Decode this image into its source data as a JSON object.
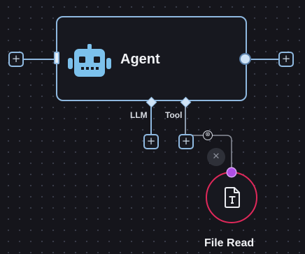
{
  "canvas": {
    "background": "#15151b",
    "accent": "#8fb9e0"
  },
  "agent_node": {
    "title": "Agent",
    "icon": "robot-icon"
  },
  "ports": {
    "llm_label": "LLM",
    "tool_label": "Tool"
  },
  "buttons": {
    "add_symbol": "+",
    "remove_edge_symbol": "⊗",
    "delete_symbol": "✕"
  },
  "tool_node": {
    "title": "File Read",
    "icon": "file-text-icon",
    "border_color": "#e0285a",
    "handle_color": "#b04fe6"
  }
}
